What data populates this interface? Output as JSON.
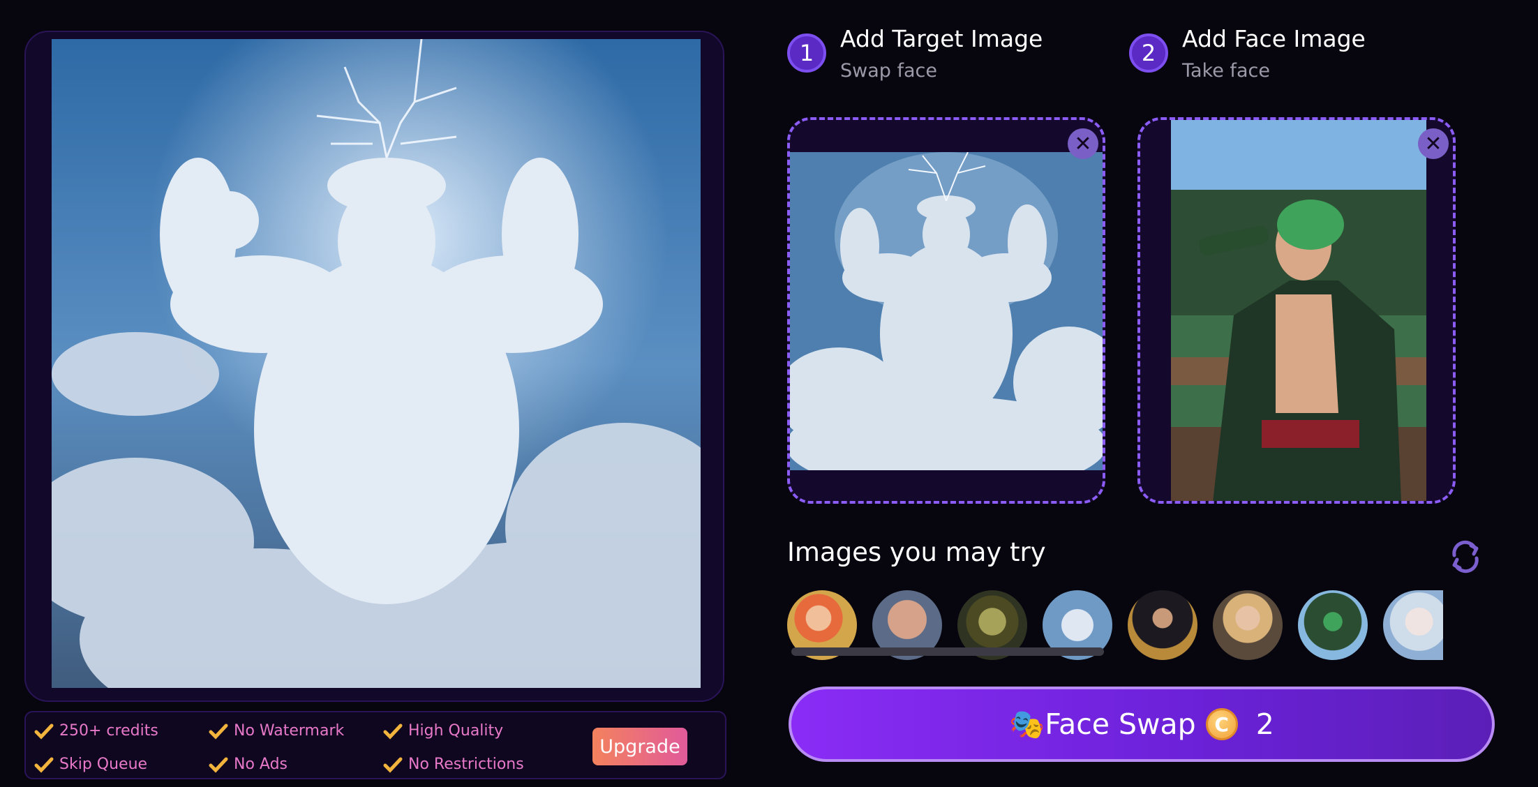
{
  "steps": [
    {
      "number": "1",
      "title": "Add Target Image",
      "subtitle": "Swap face"
    },
    {
      "number": "2",
      "title": "Add Face Image",
      "subtitle": "Take face"
    }
  ],
  "perks": [
    "250+ credits",
    "No Watermark",
    "High Quality",
    "Skip Queue",
    "No Ads",
    "No Restrictions"
  ],
  "upgrade_label": "Upgrade",
  "try_section": {
    "title": "Images you may try"
  },
  "remove_glyph": "✕",
  "swap_button": {
    "emoji": "🎭",
    "label": "Face Swap",
    "coin_glyph": "C",
    "cost": "2"
  },
  "colors": {
    "accent": "#8a2cf6",
    "perk_text": "#e879c9",
    "check": "#f2b43c",
    "dashed_border": "#8b5cf6"
  }
}
